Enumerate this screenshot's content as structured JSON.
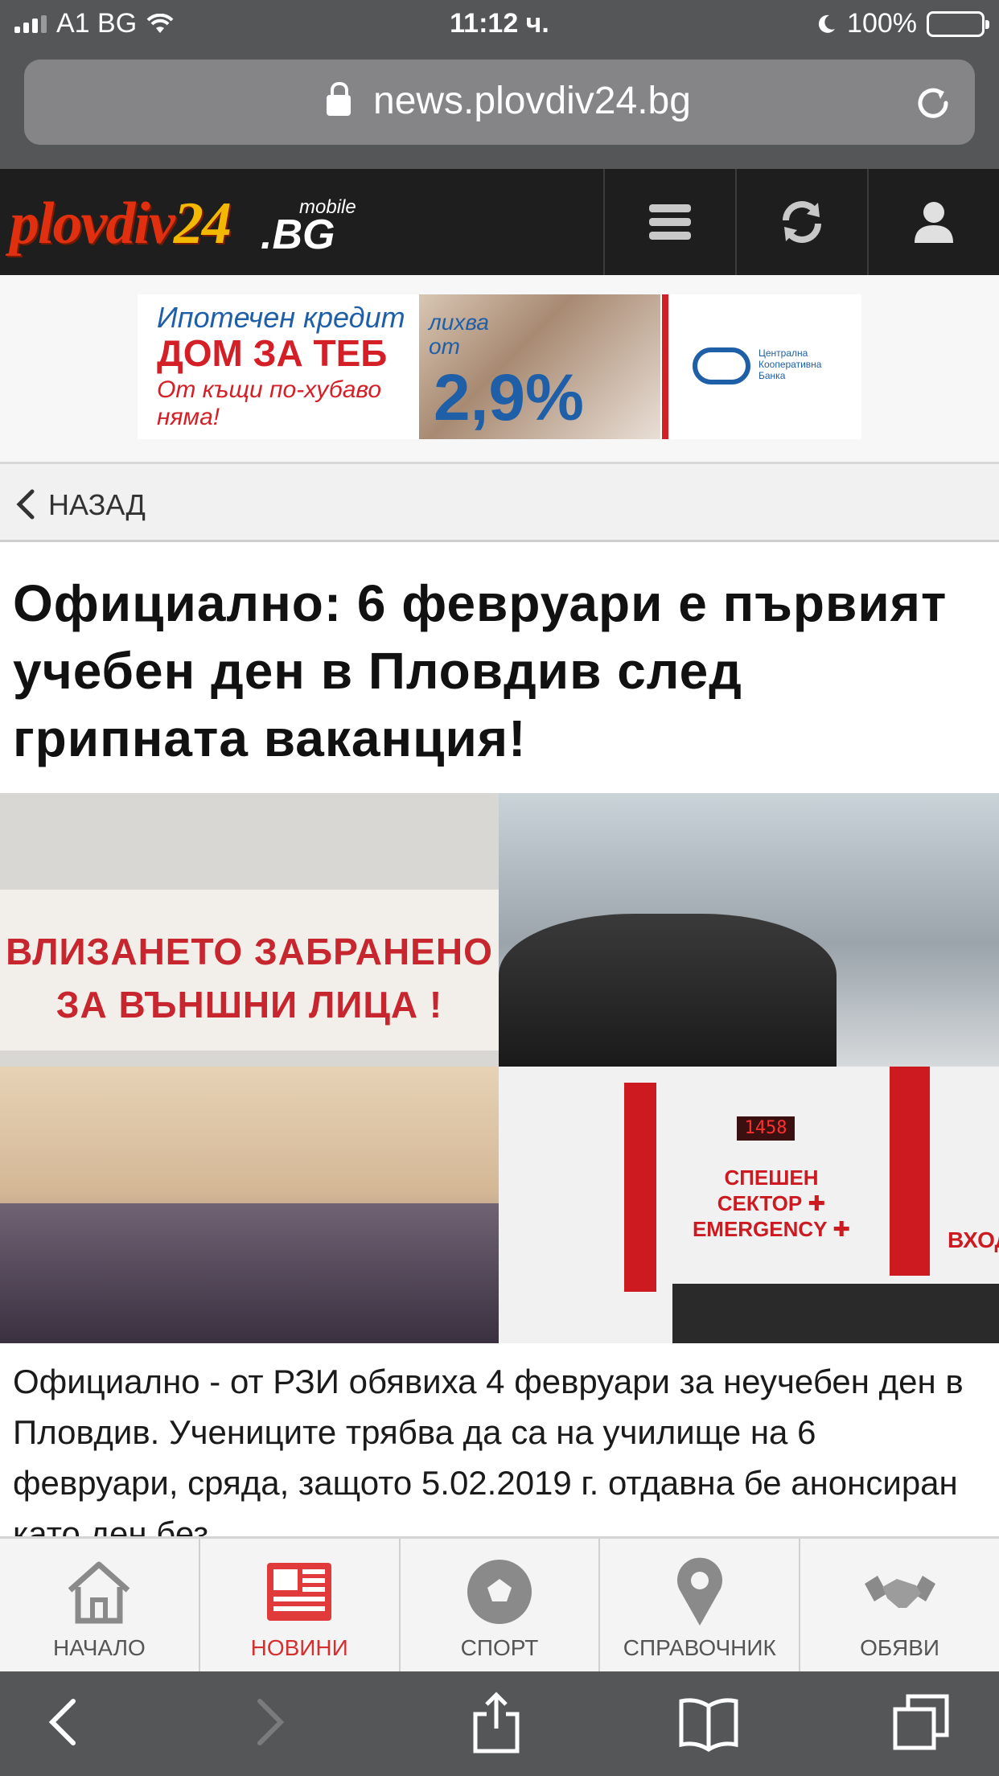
{
  "status_bar": {
    "carrier": "A1 BG",
    "time": "11:12 ч.",
    "battery_percent": "100%",
    "battery_level": 1.0
  },
  "browser": {
    "url": "news.plovdiv24.bg"
  },
  "site_header": {
    "logo_brand": "plovdiv",
    "logo_number": "24",
    "logo_tld": ".BG",
    "logo_mobile": "mobile",
    "buttons": [
      "menu-icon",
      "refresh-icon",
      "user-icon"
    ]
  },
  "ad": {
    "line1": "Ипотечен кредит",
    "line2": "ДОМ ЗА ТЕБ",
    "line3": "От къщи по-хубаво няма!",
    "rate_label": "лихва от",
    "rate": "2,9%",
    "bank_text": "Централна Кооперативна Банка",
    "colors": {
      "blue": "#1f5fa8",
      "red": "#d51f27"
    }
  },
  "back": {
    "label": "НАЗАД"
  },
  "article": {
    "headline": "Официално: 6 февруари е първият учебен ден в Пловдив след грипната ваканция!",
    "image_texts": {
      "sign_line1": "ВЛИЗАНЕТО ЗАБРАНЕНО",
      "sign_line2": "ЗА ВЪНШНИ ЛИЦА !",
      "clock": "1458",
      "emergency": "СПЕШЕН СЕКТОР ✚ EMERGENCY ✚",
      "entrance": "ВХОД"
    },
    "body": "Официално - от РЗИ обявиха 4 февруари за неучебен ден в Пловдив. Учениците трябва да са на училище на 6 февруари, сряда, защото 5.02.2019 г. отдавна бе анонсиран като ден без"
  },
  "site_nav": {
    "items": [
      {
        "label": "НАЧАЛО",
        "icon": "home-icon",
        "active": false
      },
      {
        "label": "НОВИНИ",
        "icon": "newspaper-icon",
        "active": true
      },
      {
        "label": "СПОРТ",
        "icon": "football-icon",
        "active": false
      },
      {
        "label": "СПРАВОЧНИК",
        "icon": "map-pin-icon",
        "active": false
      },
      {
        "label": "ОБЯВИ",
        "icon": "handshake-icon",
        "active": false
      }
    ],
    "colors": {
      "active": "#d62f2f",
      "inactive": "#888888"
    }
  },
  "safari_toolbar": {
    "buttons": [
      "back-icon",
      "forward-icon",
      "share-icon",
      "bookmarks-icon",
      "tabs-icon"
    ]
  }
}
